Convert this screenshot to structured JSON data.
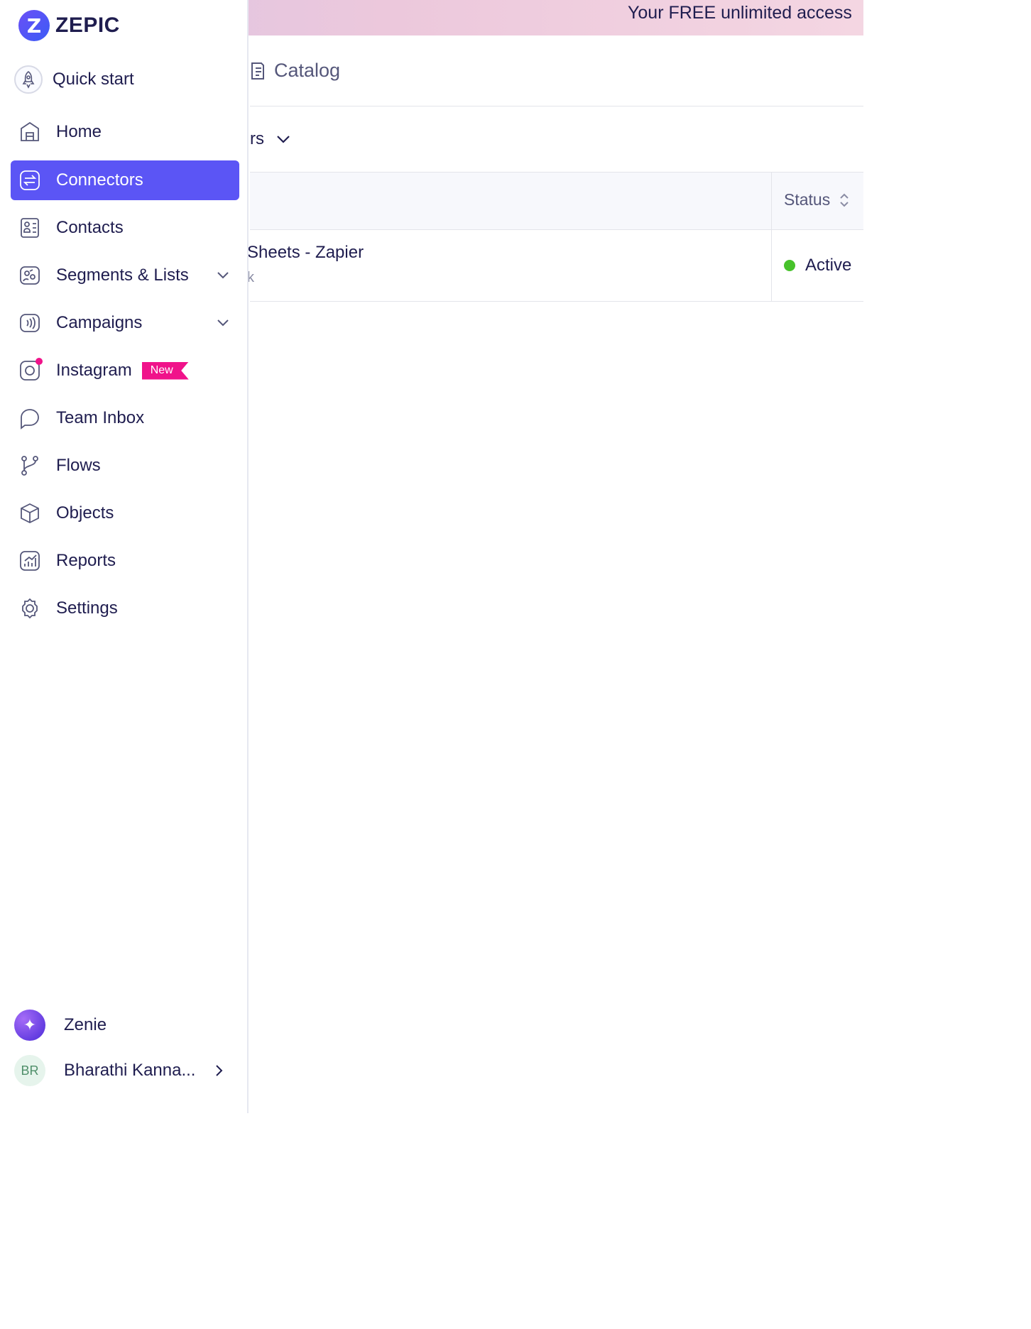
{
  "banner": {
    "text": "Your FREE unlimited access"
  },
  "main": {
    "catalog_tab": "Catalog",
    "filter_label": "rs",
    "table": {
      "status_header": "Status",
      "rows": [
        {
          "title": "Sheets - Zapier",
          "subtitle": "k",
          "status": "Active"
        }
      ]
    }
  },
  "sidebar": {
    "brand": "ZEPIC",
    "quick_start": "Quick start",
    "items": [
      {
        "label": "Home"
      },
      {
        "label": "Connectors"
      },
      {
        "label": "Contacts"
      },
      {
        "label": "Segments & Lists"
      },
      {
        "label": "Campaigns"
      },
      {
        "label": "Instagram",
        "badge": "New"
      },
      {
        "label": "Team Inbox"
      },
      {
        "label": "Flows"
      },
      {
        "label": "Objects"
      },
      {
        "label": "Reports"
      },
      {
        "label": "Settings"
      }
    ],
    "zenie": "Zenie",
    "user": {
      "initials": "BR",
      "name": "Bharathi Kanna..."
    }
  },
  "colors": {
    "accent": "#5b55f5",
    "badge": "#f0138a",
    "status_active": "#47c22b",
    "text": "#1f1d4f"
  }
}
